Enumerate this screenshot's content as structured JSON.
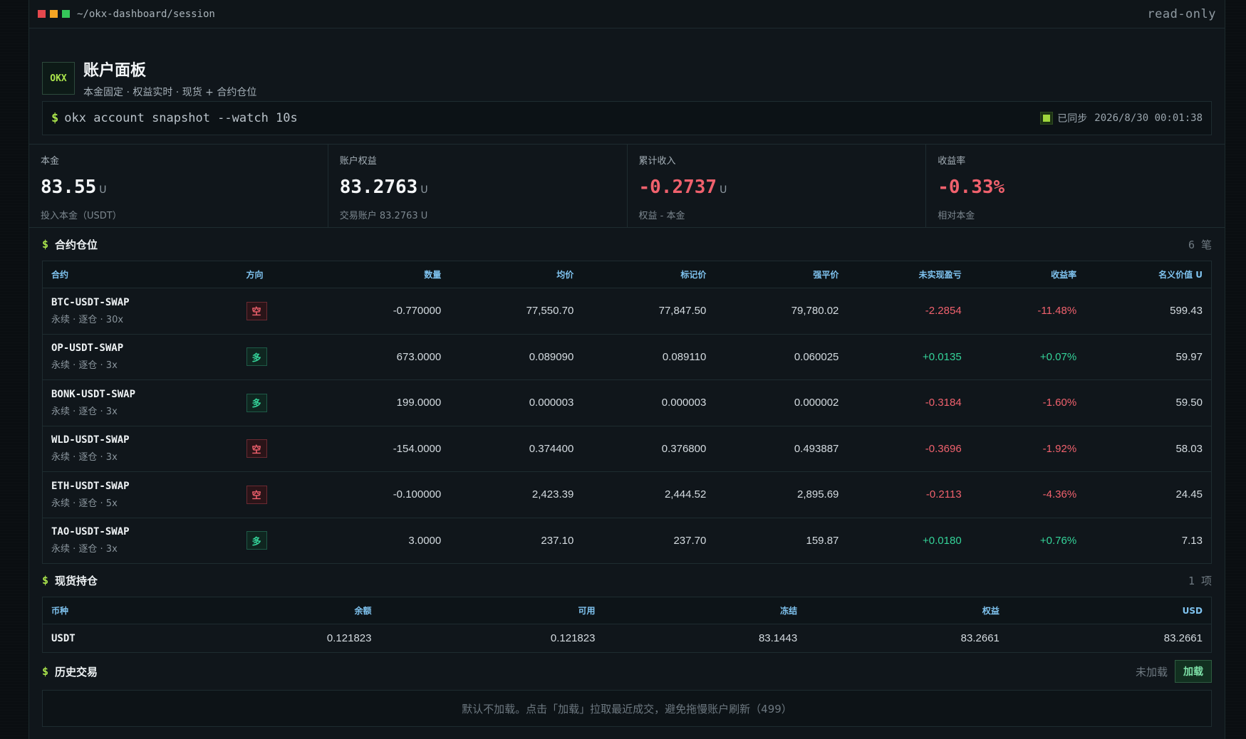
{
  "window": {
    "path": "~/okx-dashboard/session",
    "mode": "read-only",
    "dots": [
      "#e5484d",
      "#f5a524",
      "#35c759"
    ]
  },
  "header": {
    "logo": "OKX",
    "title": "账户面板",
    "subtitle": "本金固定 · 权益实时 · 现货 + 合约仓位"
  },
  "command": {
    "prompt": "$",
    "text": "okx account snapshot --watch 10s",
    "sync_label": "已同步",
    "sync_time": "2026/8/30 00:01:38"
  },
  "stats": [
    {
      "label": "本金",
      "value": "83.55",
      "unit": "U",
      "note": "投入本金（USDT）",
      "tone": ""
    },
    {
      "label": "账户权益",
      "value": "83.2763",
      "unit": "U",
      "note": "交易账户 83.2763 U",
      "tone": ""
    },
    {
      "label": "累计收入",
      "value": "-0.2737",
      "unit": "U",
      "note": "权益 - 本金",
      "tone": "neg"
    },
    {
      "label": "收益率",
      "value": "-0.33%",
      "unit": "",
      "note": "相对本金",
      "tone": "neg"
    }
  ],
  "positions": {
    "title": "合约仓位",
    "count": "6 笔",
    "headers": [
      "合约",
      "方向",
      "数量",
      "均价",
      "标记价",
      "强平价",
      "未实现盈亏",
      "收益率",
      "名义价值 U"
    ],
    "rows": [
      {
        "inst": "BTC-USDT-SWAP",
        "sub": "永续 · 逐仓 · 30x",
        "side": "空",
        "side_type": "short",
        "qty": "-0.770000",
        "avg": "77,550.70",
        "mark": "77,847.50",
        "liq": "79,780.02",
        "upl": "-2.2854",
        "ratio": "-11.48%",
        "notional": "599.43",
        "tone": "neg"
      },
      {
        "inst": "OP-USDT-SWAP",
        "sub": "永续 · 逐仓 · 3x",
        "side": "多",
        "side_type": "long",
        "qty": "673.0000",
        "avg": "0.089090",
        "mark": "0.089110",
        "liq": "0.060025",
        "upl": "+0.0135",
        "ratio": "+0.07%",
        "notional": "59.97",
        "tone": "pos"
      },
      {
        "inst": "BONK-USDT-SWAP",
        "sub": "永续 · 逐仓 · 3x",
        "side": "多",
        "side_type": "long",
        "qty": "199.0000",
        "avg": "0.000003",
        "mark": "0.000003",
        "liq": "0.000002",
        "upl": "-0.3184",
        "ratio": "-1.60%",
        "notional": "59.50",
        "tone": "neg"
      },
      {
        "inst": "WLD-USDT-SWAP",
        "sub": "永续 · 逐仓 · 3x",
        "side": "空",
        "side_type": "short",
        "qty": "-154.0000",
        "avg": "0.374400",
        "mark": "0.376800",
        "liq": "0.493887",
        "upl": "-0.3696",
        "ratio": "-1.92%",
        "notional": "58.03",
        "tone": "neg"
      },
      {
        "inst": "ETH-USDT-SWAP",
        "sub": "永续 · 逐仓 · 5x",
        "side": "空",
        "side_type": "short",
        "qty": "-0.100000",
        "avg": "2,423.39",
        "mark": "2,444.52",
        "liq": "2,895.69",
        "upl": "-0.2113",
        "ratio": "-4.36%",
        "notional": "24.45",
        "tone": "neg"
      },
      {
        "inst": "TAO-USDT-SWAP",
        "sub": "永续 · 逐仓 · 3x",
        "side": "多",
        "side_type": "long",
        "qty": "3.0000",
        "avg": "237.10",
        "mark": "237.70",
        "liq": "159.87",
        "upl": "+0.0180",
        "ratio": "+0.76%",
        "notional": "7.13",
        "tone": "pos"
      }
    ]
  },
  "spot": {
    "title": "现货持仓",
    "count": "1 项",
    "headers": [
      "币种",
      "余额",
      "可用",
      "冻结",
      "权益",
      "USD"
    ],
    "rows": [
      {
        "ccy": "USDT",
        "balance": "0.121823",
        "avail": "0.121823",
        "frozen": "83.1443",
        "equity": "83.2661",
        "usd": "83.2661"
      }
    ]
  },
  "history": {
    "title": "历史交易",
    "status": "未加载",
    "load_label": "加载",
    "empty_text": "默认不加载。点击「加载」拉取最近成交，避免拖慢账户刷新（499）"
  }
}
